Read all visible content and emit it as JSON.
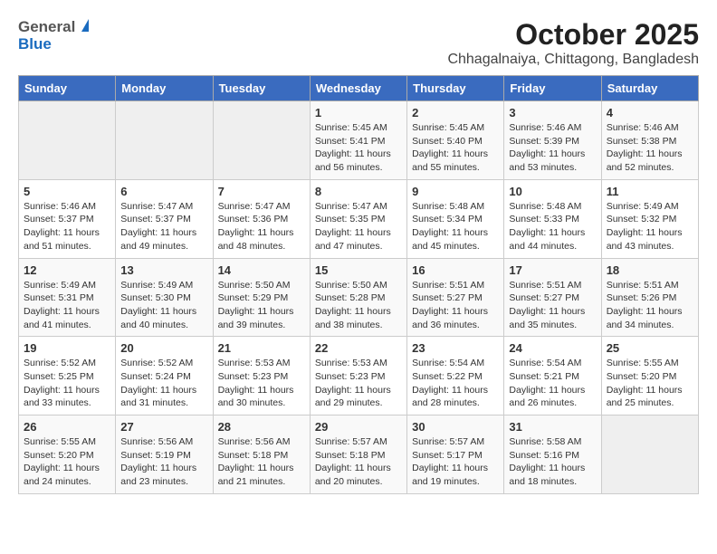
{
  "logo": {
    "general": "General",
    "blue": "Blue"
  },
  "title": "October 2025",
  "subtitle": "Chhagalnaiya, Chittagong, Bangladesh",
  "weekdays": [
    "Sunday",
    "Monday",
    "Tuesday",
    "Wednesday",
    "Thursday",
    "Friday",
    "Saturday"
  ],
  "weeks": [
    [
      {
        "day": "",
        "info": ""
      },
      {
        "day": "",
        "info": ""
      },
      {
        "day": "",
        "info": ""
      },
      {
        "day": "1",
        "info": "Sunrise: 5:45 AM\nSunset: 5:41 PM\nDaylight: 11 hours\nand 56 minutes."
      },
      {
        "day": "2",
        "info": "Sunrise: 5:45 AM\nSunset: 5:40 PM\nDaylight: 11 hours\nand 55 minutes."
      },
      {
        "day": "3",
        "info": "Sunrise: 5:46 AM\nSunset: 5:39 PM\nDaylight: 11 hours\nand 53 minutes."
      },
      {
        "day": "4",
        "info": "Sunrise: 5:46 AM\nSunset: 5:38 PM\nDaylight: 11 hours\nand 52 minutes."
      }
    ],
    [
      {
        "day": "5",
        "info": "Sunrise: 5:46 AM\nSunset: 5:37 PM\nDaylight: 11 hours\nand 51 minutes."
      },
      {
        "day": "6",
        "info": "Sunrise: 5:47 AM\nSunset: 5:37 PM\nDaylight: 11 hours\nand 49 minutes."
      },
      {
        "day": "7",
        "info": "Sunrise: 5:47 AM\nSunset: 5:36 PM\nDaylight: 11 hours\nand 48 minutes."
      },
      {
        "day": "8",
        "info": "Sunrise: 5:47 AM\nSunset: 5:35 PM\nDaylight: 11 hours\nand 47 minutes."
      },
      {
        "day": "9",
        "info": "Sunrise: 5:48 AM\nSunset: 5:34 PM\nDaylight: 11 hours\nand 45 minutes."
      },
      {
        "day": "10",
        "info": "Sunrise: 5:48 AM\nSunset: 5:33 PM\nDaylight: 11 hours\nand 44 minutes."
      },
      {
        "day": "11",
        "info": "Sunrise: 5:49 AM\nSunset: 5:32 PM\nDaylight: 11 hours\nand 43 minutes."
      }
    ],
    [
      {
        "day": "12",
        "info": "Sunrise: 5:49 AM\nSunset: 5:31 PM\nDaylight: 11 hours\nand 41 minutes."
      },
      {
        "day": "13",
        "info": "Sunrise: 5:49 AM\nSunset: 5:30 PM\nDaylight: 11 hours\nand 40 minutes."
      },
      {
        "day": "14",
        "info": "Sunrise: 5:50 AM\nSunset: 5:29 PM\nDaylight: 11 hours\nand 39 minutes."
      },
      {
        "day": "15",
        "info": "Sunrise: 5:50 AM\nSunset: 5:28 PM\nDaylight: 11 hours\nand 38 minutes."
      },
      {
        "day": "16",
        "info": "Sunrise: 5:51 AM\nSunset: 5:27 PM\nDaylight: 11 hours\nand 36 minutes."
      },
      {
        "day": "17",
        "info": "Sunrise: 5:51 AM\nSunset: 5:27 PM\nDaylight: 11 hours\nand 35 minutes."
      },
      {
        "day": "18",
        "info": "Sunrise: 5:51 AM\nSunset: 5:26 PM\nDaylight: 11 hours\nand 34 minutes."
      }
    ],
    [
      {
        "day": "19",
        "info": "Sunrise: 5:52 AM\nSunset: 5:25 PM\nDaylight: 11 hours\nand 33 minutes."
      },
      {
        "day": "20",
        "info": "Sunrise: 5:52 AM\nSunset: 5:24 PM\nDaylight: 11 hours\nand 31 minutes."
      },
      {
        "day": "21",
        "info": "Sunrise: 5:53 AM\nSunset: 5:23 PM\nDaylight: 11 hours\nand 30 minutes."
      },
      {
        "day": "22",
        "info": "Sunrise: 5:53 AM\nSunset: 5:23 PM\nDaylight: 11 hours\nand 29 minutes."
      },
      {
        "day": "23",
        "info": "Sunrise: 5:54 AM\nSunset: 5:22 PM\nDaylight: 11 hours\nand 28 minutes."
      },
      {
        "day": "24",
        "info": "Sunrise: 5:54 AM\nSunset: 5:21 PM\nDaylight: 11 hours\nand 26 minutes."
      },
      {
        "day": "25",
        "info": "Sunrise: 5:55 AM\nSunset: 5:20 PM\nDaylight: 11 hours\nand 25 minutes."
      }
    ],
    [
      {
        "day": "26",
        "info": "Sunrise: 5:55 AM\nSunset: 5:20 PM\nDaylight: 11 hours\nand 24 minutes."
      },
      {
        "day": "27",
        "info": "Sunrise: 5:56 AM\nSunset: 5:19 PM\nDaylight: 11 hours\nand 23 minutes."
      },
      {
        "day": "28",
        "info": "Sunrise: 5:56 AM\nSunset: 5:18 PM\nDaylight: 11 hours\nand 21 minutes."
      },
      {
        "day": "29",
        "info": "Sunrise: 5:57 AM\nSunset: 5:18 PM\nDaylight: 11 hours\nand 20 minutes."
      },
      {
        "day": "30",
        "info": "Sunrise: 5:57 AM\nSunset: 5:17 PM\nDaylight: 11 hours\nand 19 minutes."
      },
      {
        "day": "31",
        "info": "Sunrise: 5:58 AM\nSunset: 5:16 PM\nDaylight: 11 hours\nand 18 minutes."
      },
      {
        "day": "",
        "info": ""
      }
    ]
  ]
}
